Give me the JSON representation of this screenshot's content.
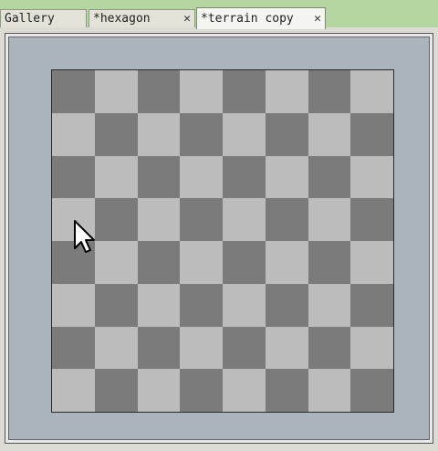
{
  "tabs": [
    {
      "label": "Gallery",
      "active": false,
      "closable": false
    },
    {
      "label": "*hexagon",
      "active": false,
      "closable": true
    },
    {
      "label": "*terrain copy",
      "active": true,
      "closable": true
    }
  ],
  "close_glyph": "✕",
  "board": {
    "rows": 8,
    "cols": 8,
    "dark_color": "#7b7b7b",
    "light_color": "#bcbcbc"
  },
  "colors": {
    "tabbar": "#b5d6a0",
    "canvas": "#aab4ba"
  },
  "icons": {
    "cursor": "arrow-cursor-icon"
  }
}
